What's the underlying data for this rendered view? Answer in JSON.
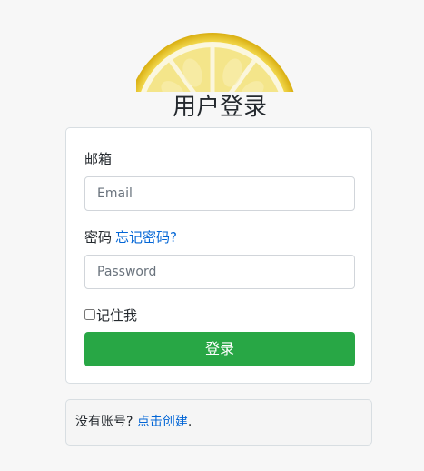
{
  "page": {
    "title": "用户登录"
  },
  "logo": {
    "icon": "lemon-slice-logo",
    "colors": {
      "rind": "#e8c21c",
      "pith": "#f8f2cc",
      "flesh": "#f3e27a"
    }
  },
  "form": {
    "email_label": "邮箱",
    "email_placeholder": "Email",
    "email_value": "",
    "password_label": "密码",
    "forgot_password": "忘记密码?",
    "password_placeholder": "Password",
    "password_value": "",
    "remember_label": "记住我",
    "remember_checked": false,
    "submit_label": "登录"
  },
  "signup": {
    "prompt": "没有账号?",
    "link": "点击创建",
    "suffix": "."
  },
  "colors": {
    "background": "#f7f7f7",
    "primary_button": "#28a745",
    "link": "#0366d6"
  }
}
